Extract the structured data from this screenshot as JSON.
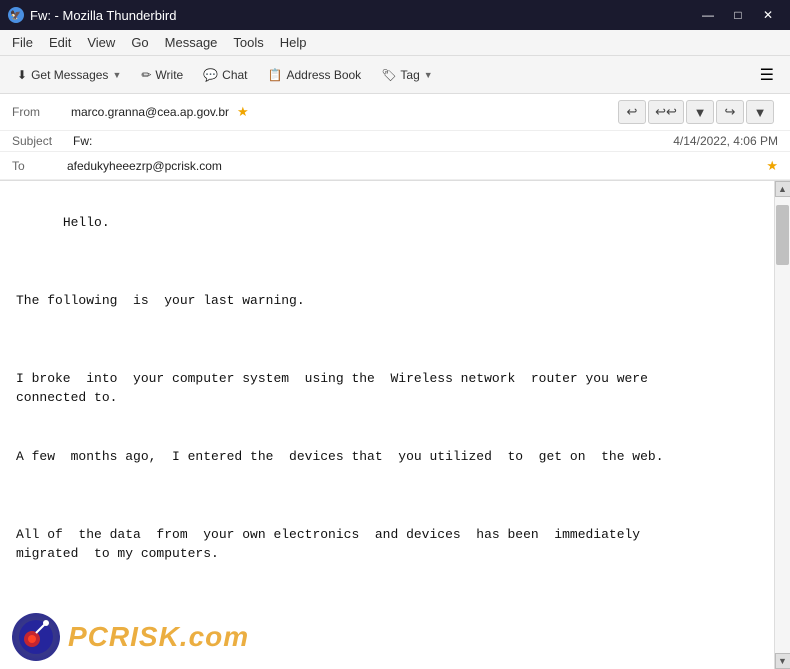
{
  "titlebar": {
    "title": "Fw: - Mozilla Thunderbird",
    "icon": "🦅",
    "minimize": "—",
    "maximize": "□",
    "close": "✕"
  },
  "menubar": {
    "items": [
      "File",
      "Edit",
      "View",
      "Go",
      "Message",
      "Tools",
      "Help"
    ]
  },
  "toolbar": {
    "get_messages": "Get Messages",
    "write": "Write",
    "chat": "Chat",
    "address_book": "Address Book",
    "tag": "Tag",
    "hamburger": "☰"
  },
  "header": {
    "from_label": "From",
    "from_value": "marco.granna@cea.ap.gov.br",
    "subject_label": "Subject",
    "subject_value": "Fw:",
    "date": "4/14/2022, 4:06 PM",
    "to_label": "To",
    "to_value": "afedukyheeezrp@pcrisk.com"
  },
  "nav_buttons": {
    "reply": "↩",
    "reply_all": "↩↩",
    "forward_down": "▼",
    "forward": "↪",
    "more": "▼"
  },
  "message": {
    "body": "Hello.\n\n\n\nThe following  is  your last warning.\n\n\n\nI broke  into  your computer system  using the  Wireless network  router you were\nconnected to.\n\n\nA few  months ago,  I entered the  devices that  you utilized  to  get on  the web.\n\n\n\nAll of  the data  from  your own electronics  and devices  has been  immediately\nmigrated  to my computers."
  },
  "watermark": {
    "text": "PCRISK.com"
  }
}
